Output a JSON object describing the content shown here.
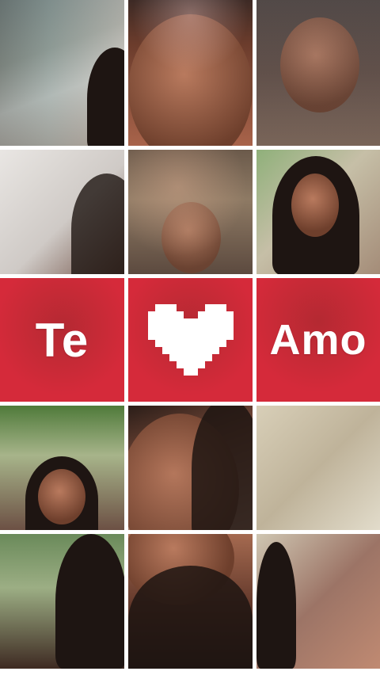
{
  "collage": {
    "center_row": {
      "left_word": "Te",
      "right_word": "Amo",
      "center_symbol": "pixel-heart-icon"
    },
    "colors": {
      "tile_red": "#d52a3a",
      "divider": "#ffffff",
      "heart": "#ffffff"
    }
  }
}
